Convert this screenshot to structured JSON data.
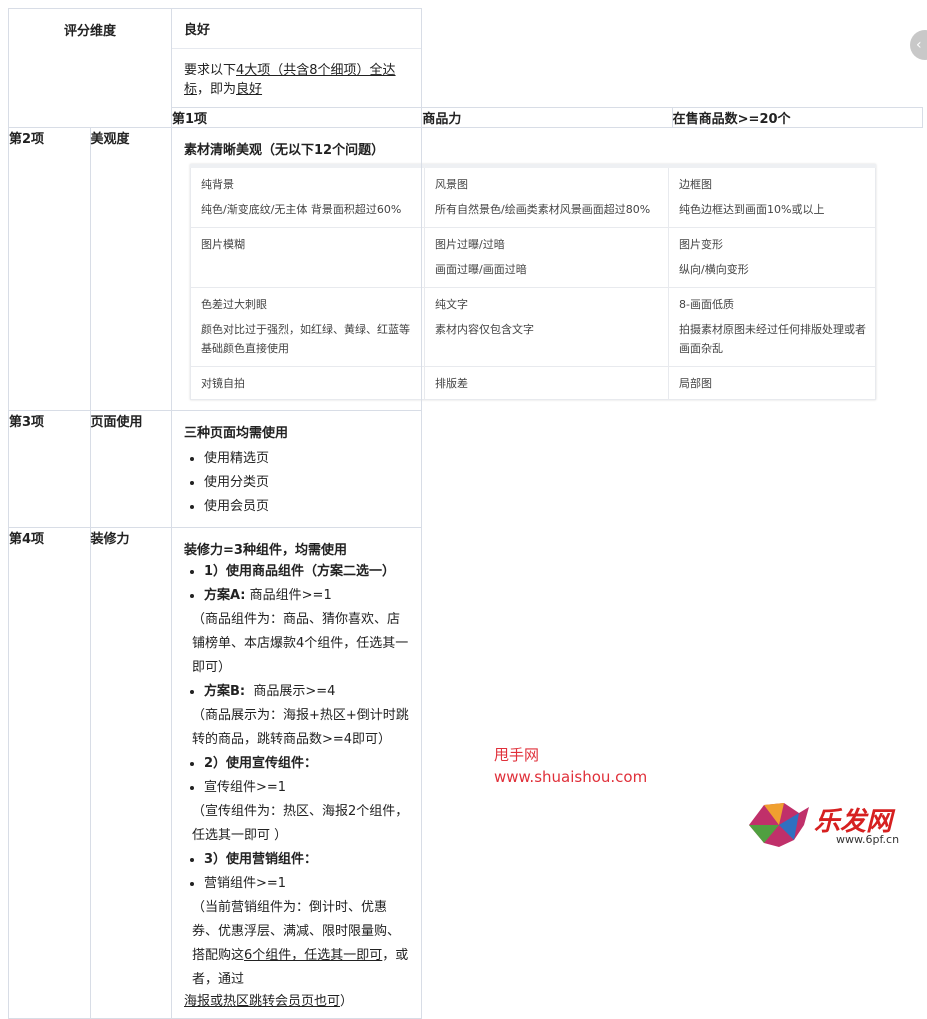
{
  "header": {
    "col_label": "评分维度",
    "grade": "良好",
    "req_prefix": "要求以下",
    "req_u1": "4大项（共含8个细项）全达标",
    "req_mid": "，即为",
    "req_u2": "良好"
  },
  "rows": [
    {
      "id": "第1项",
      "name": "商品力",
      "title": "在售商品数>=20个"
    },
    {
      "id": "第2项",
      "name": "美观度",
      "title": "素材清晰美观（无以下12个问题）"
    },
    {
      "id": "第3项",
      "name": "页面使用",
      "title": "三种页面均需使用"
    },
    {
      "id": "第4项",
      "name": "装修力",
      "title": "装修力=3种组件，均需使用"
    }
  ],
  "image_table": [
    [
      {
        "t": "纯背景",
        "d": "纯色/渐变底纹/无主体 背景面积超过60%"
      },
      {
        "t": "风景图",
        "d": "所有自然景色/绘画类素材风景画面超过80%"
      },
      {
        "t": "边框图",
        "d": "纯色边框达到画面10%或以上"
      }
    ],
    [
      {
        "t": "图片模糊",
        "d": ""
      },
      {
        "t": "图片过曝/过暗",
        "d": "画面过曝/画面过暗"
      },
      {
        "t": "图片变形",
        "d": "纵向/横向变形"
      }
    ],
    [
      {
        "t": "色差过大刺眼",
        "d": "颜色对比过于强烈，如红绿、黄绿、红蓝等基础颜色直接使用"
      },
      {
        "t": "纯文字",
        "d": "素材内容仅包含文字"
      },
      {
        "t": "8-画面低质",
        "d": "拍摄素材原图未经过任何排版处理或者画面杂乱"
      }
    ],
    [
      {
        "t": "对镜自拍",
        "d": ""
      },
      {
        "t": "排版差",
        "d": ""
      },
      {
        "t": "局部图",
        "d": ""
      }
    ]
  ],
  "pages": [
    "使用精选页",
    "使用分类页",
    "使用会员页"
  ],
  "deco": {
    "b1": "1）使用商品组件（方案二选一）",
    "a_label": "方案A:",
    "a_text": "商品组件>=1",
    "a_note": "（商品组件为：商品、猜你喜欢、店铺榜单、本店爆款4个组件，任选其一即可）",
    "b_label": "方案B:",
    "b_text": "商品展示>=4",
    "b_note": "（商品展示为：海报+热区+倒计时跳转的商品，跳转商品数>=4即可）",
    "b2": "2）使用宣传组件：",
    "promo": "宣传组件>=1",
    "promo_note": "（宣传组件为：热区、海报2个组件，任选其一即可 ）",
    "b3": "3）使用营销组件：",
    "mkt": "营销组件>=1",
    "mkt_note_1": "（当前营销组件为：倒计时、优惠券、优惠浮层、满减、限时限量购、搭配购这",
    "mkt_note_u1": "6个组件，任选其一即可",
    "mkt_note_2": "，或者，通过",
    "mkt_note_u2": "海报或热区跳转会员页也可",
    "mkt_note_3": "）"
  },
  "watermark": {
    "name": "甩手网",
    "url": "www.shuaishou.com",
    "logo_text": "乐发网",
    "logo_url": "www.6pf.cn"
  },
  "colors": {
    "border": "#d8dde6",
    "watermark": "#e0303a"
  }
}
